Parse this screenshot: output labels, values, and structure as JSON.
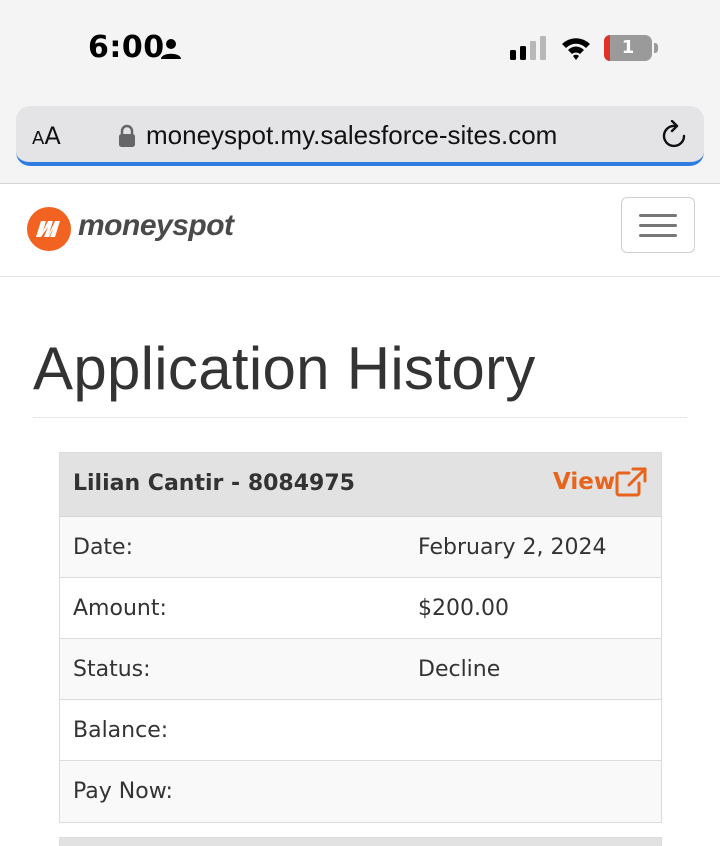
{
  "status_bar": {
    "time": "6:00",
    "battery_level": "1",
    "icons": [
      "person-icon",
      "cellular-signal-icon",
      "wifi-icon",
      "battery-icon"
    ]
  },
  "browser": {
    "text_size_small": "A",
    "text_size_large": "A",
    "url": "moneyspot.my.salesforce-sites.com",
    "icons": [
      "lock-icon",
      "reload-icon"
    ]
  },
  "navbar": {
    "brand": "moneyspot",
    "icons": [
      "moneyspot-logo-icon",
      "hamburger-menu-icon"
    ]
  },
  "colors": {
    "accent": "#f26322",
    "link": "#e8641c",
    "text": "#333333",
    "card_header_bg": "#e2e2e2",
    "url_underline": "#2f7de1"
  },
  "main": {
    "title": "Application History",
    "applications": [
      {
        "header": "Lilian Cantir - 8084975",
        "view_label": "View",
        "rows": [
          {
            "label": "Date:",
            "value": "February 2, 2024"
          },
          {
            "label": "Amount:",
            "value": "$200.00"
          },
          {
            "label": "Status:",
            "value": "Decline"
          },
          {
            "label": "Balance:",
            "value": ""
          },
          {
            "label": "Pay Now:",
            "value": ""
          }
        ]
      }
    ]
  }
}
